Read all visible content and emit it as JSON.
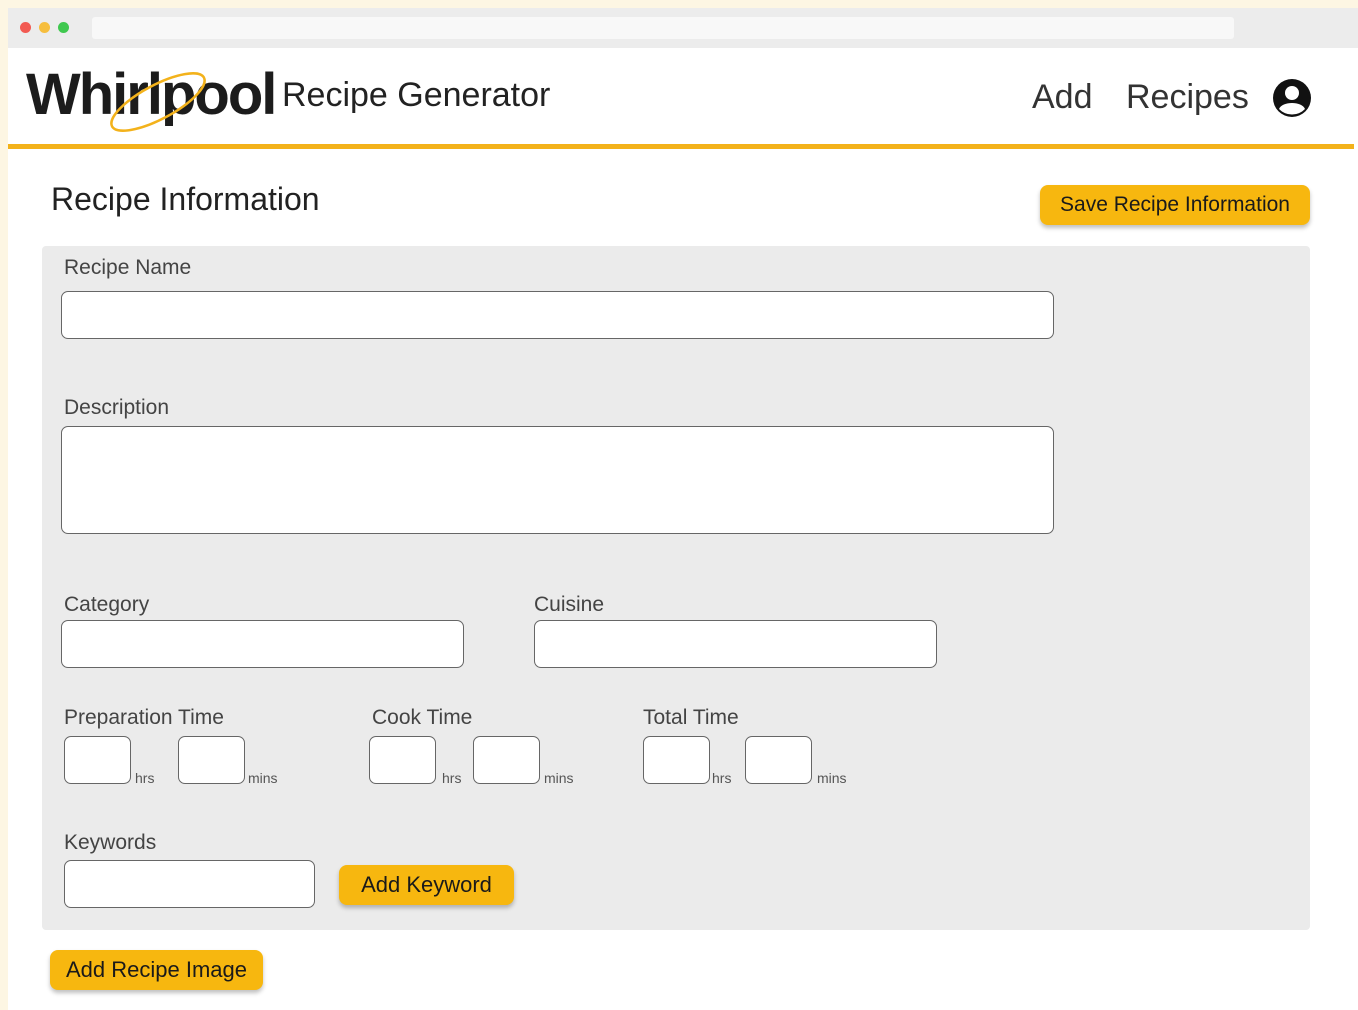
{
  "brand": {
    "logo_text": "Whirlpool",
    "app_title": "Recipe Generator",
    "accent_color": "#f3b21b",
    "button_color": "#f7b70f"
  },
  "nav": {
    "add_label": "Add",
    "recipes_label": "Recipes",
    "account_icon": "account-circle-icon"
  },
  "page": {
    "section_title": "Recipe Information",
    "save_button_label": "Save Recipe Information"
  },
  "form": {
    "recipe_name": {
      "label": "Recipe Name",
      "value": ""
    },
    "description": {
      "label": "Description",
      "value": ""
    },
    "category": {
      "label": "Category",
      "value": ""
    },
    "cuisine": {
      "label": "Cuisine",
      "value": ""
    },
    "prep_time": {
      "label": "Preparation Time",
      "hrs_unit": "hrs",
      "mins_unit": "mins"
    },
    "cook_time": {
      "label": "Cook Time",
      "hrs_unit": "hrs",
      "mins_unit": "mins"
    },
    "total_time": {
      "label": "Total Time",
      "hrs_unit": "hrs",
      "mins_unit": "mins"
    },
    "keywords": {
      "label": "Keywords",
      "value": "",
      "add_button_label": "Add Keyword"
    }
  },
  "footer_actions": {
    "add_image_label": "Add Recipe Image"
  }
}
